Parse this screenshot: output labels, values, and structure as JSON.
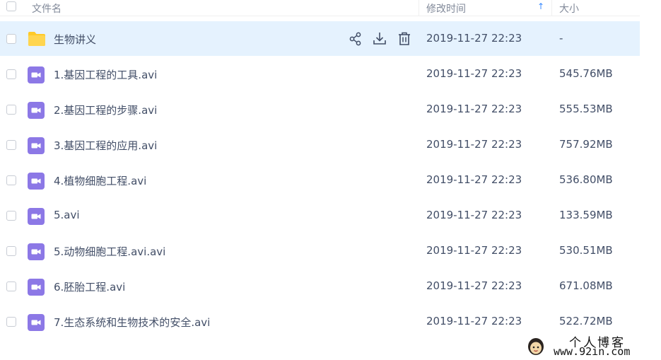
{
  "header": {
    "name_label": "文件名",
    "time_label": "修改时间",
    "sort_indicator": "↑",
    "size_label": "大小"
  },
  "row_actions": [
    "share-icon",
    "download-icon",
    "delete-icon"
  ],
  "colors": {
    "hover_row": "#e5f2fe",
    "folder": "#ffca28",
    "video": "#8c78e6",
    "accent": "#3b8cff"
  },
  "files": [
    {
      "name": "生物讲义",
      "type": "folder",
      "time": "2019-11-27 22:23",
      "size": "-"
    },
    {
      "name": "1.基因工程的工具.avi",
      "type": "video",
      "time": "2019-11-27 22:23",
      "size": "545.76MB"
    },
    {
      "name": "2.基因工程的步骤.avi",
      "type": "video",
      "time": "2019-11-27 22:23",
      "size": "555.53MB"
    },
    {
      "name": "3.基因工程的应用.avi",
      "type": "video",
      "time": "2019-11-27 22:23",
      "size": "757.92MB"
    },
    {
      "name": "4.植物细胞工程.avi",
      "type": "video",
      "time": "2019-11-27 22:23",
      "size": "536.80MB"
    },
    {
      "name": "5.avi",
      "type": "video",
      "time": "2019-11-27 22:23",
      "size": "133.59MB"
    },
    {
      "name": "5.动物细胞工程.avi.avi",
      "type": "video",
      "time": "2019-11-27 22:23",
      "size": "530.51MB"
    },
    {
      "name": "6.胚胎工程.avi",
      "type": "video",
      "time": "2019-11-27 22:23",
      "size": "671.08MB"
    },
    {
      "name": "7.生态系统和生物技术的安全.avi",
      "type": "video",
      "time": "2019-11-27 22:23",
      "size": "522.72MB"
    }
  ],
  "watermark": {
    "title": "个人博客",
    "url": "www.92in.com"
  }
}
